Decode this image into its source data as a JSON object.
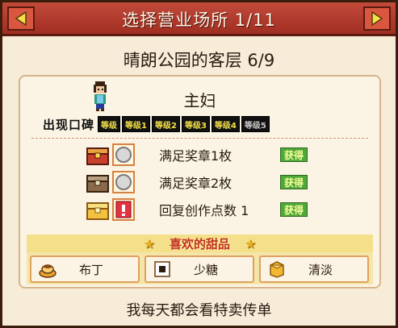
{
  "header": {
    "title": "选择营业场所 1/11"
  },
  "subtitle": "晴朗公园的客层 6/9",
  "customer": {
    "name": "主妇",
    "appear_label": "出现口碑",
    "levels": [
      "等级",
      "等级1",
      "等级2",
      "等级3",
      "等级4",
      "等级5"
    ]
  },
  "requirements": [
    {
      "text": "满足奖章1枚",
      "status": "获得"
    },
    {
      "text": "满足奖章2枚",
      "status": "获得"
    },
    {
      "text": "回复创作点数 1",
      "status": "获得"
    }
  ],
  "favorites": {
    "title": "喜欢的甜品",
    "items": [
      {
        "label": "布丁",
        "icon": "pudding-icon"
      },
      {
        "label": "少糖",
        "icon": "low-sugar-icon"
      },
      {
        "label": "清淡",
        "icon": "light-flavor-icon"
      }
    ]
  },
  "footer": "我每天都会看特卖传单",
  "colors": {
    "header_red": "#b23a2c",
    "accent_gold": "#f4e08a",
    "status_green": "#4fa83a"
  }
}
